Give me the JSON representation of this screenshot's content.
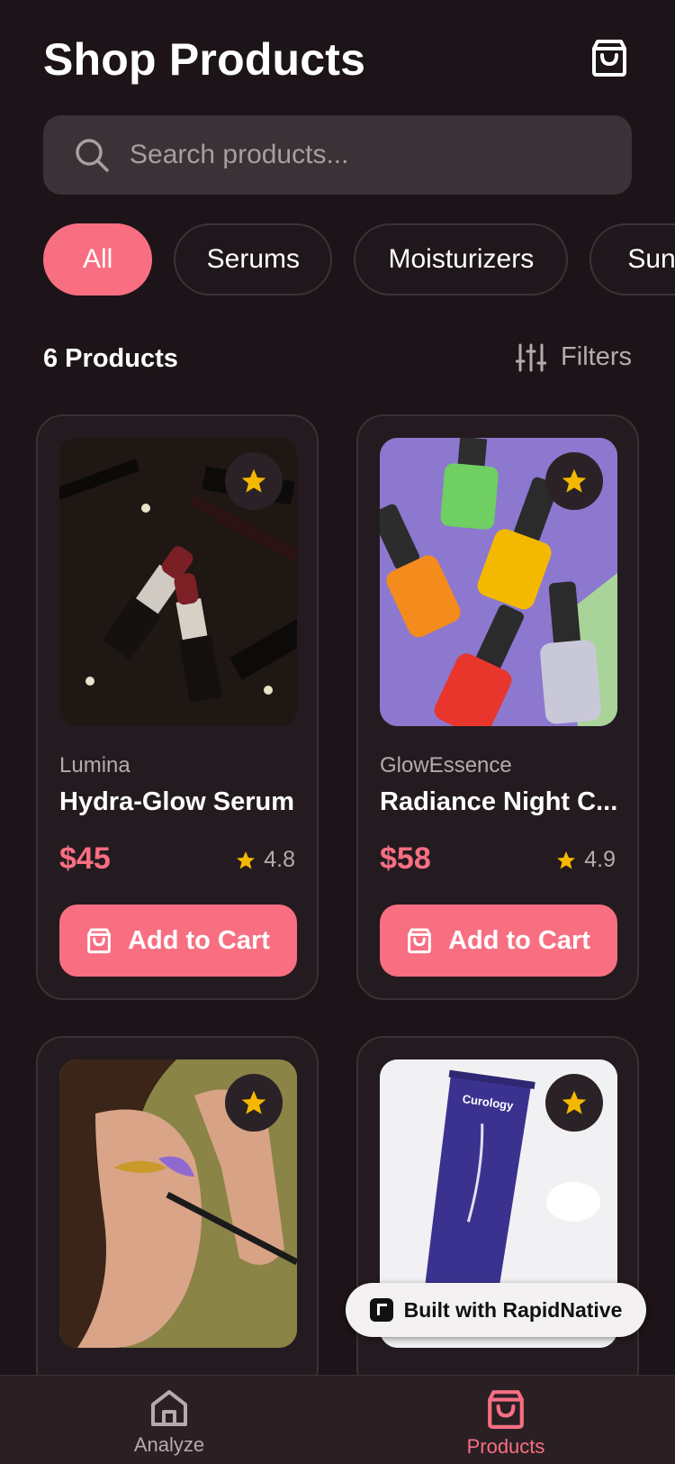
{
  "header": {
    "title": "Shop Products",
    "cart_icon": "shopping-bag-icon"
  },
  "search": {
    "placeholder": "Search products...",
    "value": "",
    "icon": "search-icon"
  },
  "categories": [
    {
      "label": "All",
      "active": true
    },
    {
      "label": "Serums",
      "active": false
    },
    {
      "label": "Moisturizers",
      "active": false
    },
    {
      "label": "Sun",
      "active": false
    }
  ],
  "summary": {
    "count_label": "6 Products",
    "filters_label": "Filters"
  },
  "products": [
    {
      "brand": "Lumina",
      "name": "Hydra-Glow Serum",
      "price": "$45",
      "rating": "4.8",
      "add_label": "Add to Cart",
      "image": "lipsticks-photo"
    },
    {
      "brand": "GlowEssence",
      "name": "Radiance Night C...",
      "price": "$58",
      "rating": "4.9",
      "add_label": "Add to Cart",
      "image": "nail-lacquer-photo"
    },
    {
      "brand": "",
      "name": "",
      "price": "",
      "rating": "",
      "add_label": "",
      "image": "eyeshadow-application-photo"
    },
    {
      "brand": "",
      "name": "",
      "price": "",
      "rating": "",
      "add_label": "",
      "image": "cleanser-tube-photo",
      "tube_text": "Curology"
    }
  ],
  "badge": {
    "label": "Built with RapidNative"
  },
  "tabs": [
    {
      "label": "Analyze",
      "icon": "home-icon",
      "active": false
    },
    {
      "label": "Products",
      "icon": "shopping-bag-icon",
      "active": true
    }
  ],
  "colors": {
    "accent": "#f86f82",
    "background": "#1c1418",
    "card": "#241b20",
    "star": "#f5b800"
  }
}
